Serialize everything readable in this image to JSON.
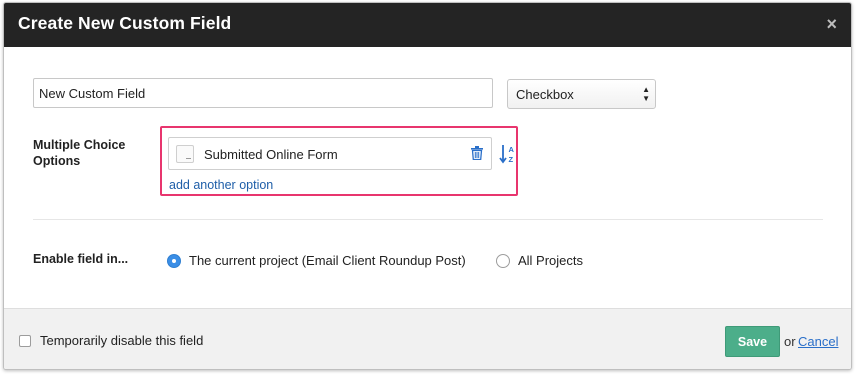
{
  "dialog": {
    "title": "Create New Custom Field",
    "close_icon": "close-icon",
    "close_glyph": "×"
  },
  "field": {
    "name_value": "New Custom Field",
    "type_value": "Checkbox"
  },
  "options": {
    "label": "Multiple Choice Options",
    "items": [
      {
        "text": "Submitted Online Form"
      }
    ],
    "add_link": "add another option",
    "highlight_color": "#e8356e"
  },
  "enable": {
    "label": "Enable field in...",
    "choices": [
      {
        "label": "The current project (Email Client Roundup Post)",
        "selected": true
      },
      {
        "label": "All Projects",
        "selected": false
      }
    ]
  },
  "footer": {
    "disable_label": "Temporarily disable this field",
    "disable_checked": false,
    "save_label": "Save",
    "or_text": "or",
    "cancel_label": "Cancel"
  },
  "colors": {
    "header_bg": "#242424",
    "save_bg": "#4cae8a",
    "link": "#1e5ea8",
    "radio_selected": "#3a8ee6"
  }
}
